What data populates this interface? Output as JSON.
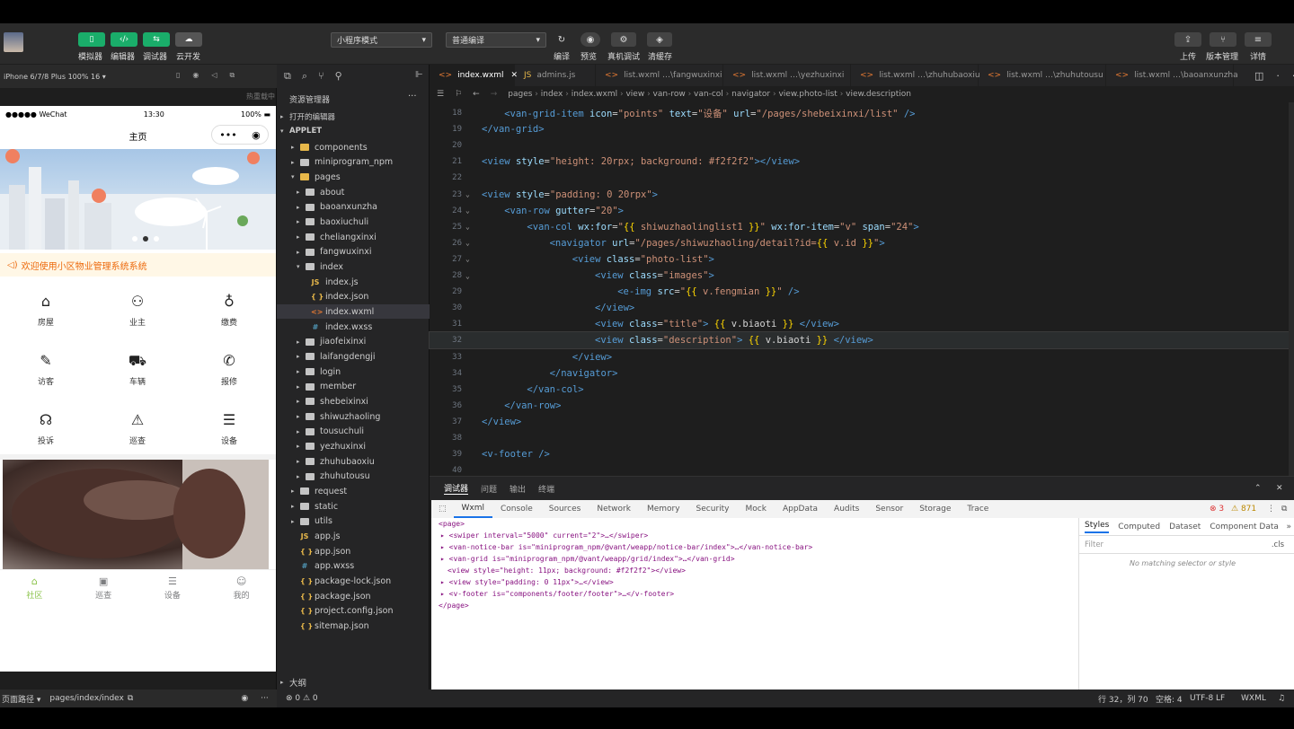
{
  "toolbar": {
    "left_buttons": [
      "模拟器",
      "编辑器",
      "调试器",
      "云开发"
    ],
    "mode_select": "小程序模式",
    "compile_select": "普通编译",
    "mid_buttons": [
      "编译",
      "预览",
      "真机调试",
      "清缓存"
    ],
    "right_buttons": [
      "上传",
      "版本管理",
      "详情"
    ]
  },
  "simulator": {
    "device": "iPhone 6/7/8 Plus 100% 16 ▾",
    "hot_reload": "热重载中",
    "status_carrier": "●●●●● WeChat",
    "status_time": "13:30",
    "status_battery": "100%",
    "nav_title": "主页",
    "notice": "欢迎使用小区物业管理系统系统",
    "grid": [
      "房屋",
      "业主",
      "缴费",
      "访客",
      "车辆",
      "报修",
      "投诉",
      "巡查",
      "设备"
    ],
    "tabs": [
      "社区",
      "巡查",
      "设备",
      "我的"
    ],
    "active_tab_color": "#8bc34a",
    "page_path_label": "页面路径 ▾",
    "page_path": "pages/index/index"
  },
  "explorer": {
    "title": "资源管理器",
    "open_editors": "打开的编辑器",
    "root": "APPLET",
    "items": [
      "components",
      "miniprogram_npm",
      "pages",
      "about",
      "baoanxunzha",
      "baoxiuchuli",
      "cheliangxinxi",
      "fangwuxinxi",
      "index",
      "index.js",
      "index.json",
      "index.wxml",
      "index.wxss",
      "jiaofeixinxi",
      "laifangdengji",
      "login",
      "member",
      "shebeixinxi",
      "shiwuzhaoling",
      "tousuchuli",
      "yezhuxinxi",
      "zhuhubaoxiu",
      "zhuhutousu",
      "request",
      "static",
      "utils",
      "app.js",
      "app.json",
      "app.wxss",
      "package-lock.json",
      "package.json",
      "project.config.json",
      "sitemap.json"
    ],
    "outline": "大纲"
  },
  "editor": {
    "tabs": [
      "index.wxml",
      "admins.js",
      "list.wxml …\\fangwuxinxi",
      "list.wxml …\\yezhuxinxi",
      "list.wxml …\\zhuhubaoxiu",
      "list.wxml …\\zhuhutousu",
      "list.wxml …\\baoanxunzha"
    ],
    "breadcrumb": [
      "pages",
      "index",
      "index.wxml",
      "view",
      "van-row",
      "van-col",
      "navigator",
      "view.photo-list",
      "view.description"
    ],
    "line_numbers": [
      "18",
      "19",
      "20",
      "21",
      "22",
      "23",
      "24",
      "25",
      "26",
      "27",
      "28",
      "29",
      "30",
      "31",
      "32",
      "33",
      "34",
      "35",
      "36",
      "37",
      "38",
      "39",
      "40"
    ]
  },
  "devtools": {
    "panel_tabs": [
      "调试器",
      "问题",
      "输出",
      "终端"
    ],
    "tabs": [
      "Wxml",
      "Console",
      "Sources",
      "Network",
      "Memory",
      "Security",
      "Mock",
      "AppData",
      "Audits",
      "Sensor",
      "Storage",
      "Trace"
    ],
    "errors": "3",
    "warnings": "871",
    "wxml_lines": [
      "<page>",
      "▸ <swiper interval=\"5000\" current=\"2\">…</swiper>",
      "▸ <van-notice-bar is=\"miniprogram_npm/@vant/weapp/notice-bar/index\">…</van-notice-bar>",
      "▸ <van-grid is=\"miniprogram_npm/@vant/weapp/grid/index\">…</van-grid>",
      "<view style=\"height: 11px; background: #f2f2f2\"></view>",
      "▸ <view style=\"padding: 0 11px\">…</view>",
      "▸ <v-footer is=\"components/footer/footer\">…</v-footer>",
      "</page>"
    ],
    "style_tabs": [
      "Styles",
      "Computed",
      "Dataset",
      "Component Data"
    ],
    "filter_placeholder": "Filter",
    "cls": ".cls",
    "no_match": "No matching selector or style"
  },
  "statusbar": {
    "problems": "⊗ 0 ⚠ 0",
    "cursor": "行 32，列 70",
    "spaces": "空格: 4",
    "encoding": "UTF-8",
    "eol": "LF",
    "lang": "WXML"
  }
}
